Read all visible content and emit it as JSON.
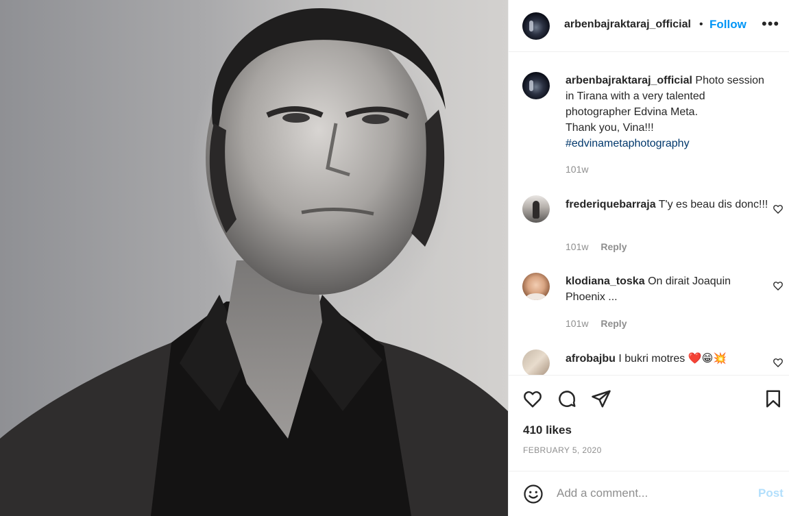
{
  "post": {
    "username": "arbenbajraktaraj_official",
    "follow_label": "Follow",
    "separator": "•",
    "more_label": "•••",
    "caption_text": "Photo session in Tirana with a very talented photographer Edvina Meta.",
    "caption_line2": "Thank you, Vina!!!",
    "hashtag": "#edvinametaphotography",
    "caption_time": "101w"
  },
  "comments": [
    {
      "username": "frederiquebarraja",
      "text": "T'y es beau dis donc!!!",
      "time": "101w",
      "reply_label": "Reply"
    },
    {
      "username": "klodiana_toska",
      "text": "On dirait Joaquin Phoenix ...",
      "time": "101w",
      "reply_label": "Reply"
    },
    {
      "username": "afrobajbu",
      "text": "I bukri motres ❤️😁💥"
    }
  ],
  "actions": {
    "likes": "410 likes",
    "date": "FEBRUARY 5, 2020"
  },
  "add_comment": {
    "placeholder": "Add a comment...",
    "post_label": "Post"
  },
  "colors": {
    "accent": "#0095f6",
    "post_disabled": "#b2dffc",
    "muted": "#8e8e8e",
    "hashtag": "#00376b"
  }
}
